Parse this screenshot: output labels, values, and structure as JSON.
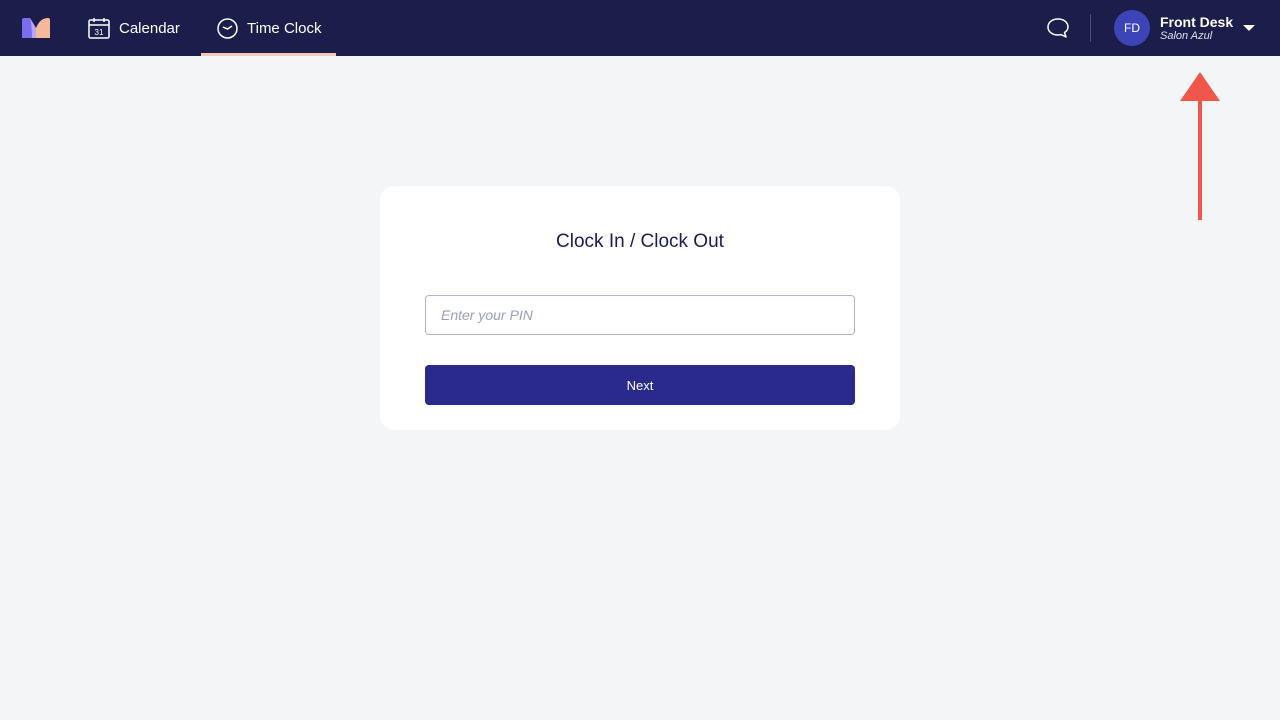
{
  "nav": {
    "items": [
      {
        "label": "Calendar",
        "icon": "calendar-icon"
      },
      {
        "label": "Time Clock",
        "icon": "clock-icon",
        "active": true
      }
    ]
  },
  "user": {
    "initials": "FD",
    "name": "Front Desk",
    "organization": "Salon Azul"
  },
  "card": {
    "title": "Clock In / Clock Out",
    "pin_value": "",
    "pin_placeholder": "Enter your PIN",
    "next_label": "Next"
  },
  "colors": {
    "topbar": "#1b1e4b",
    "accent": "#2a2a8c",
    "active_underline": "#f6c9b5",
    "avatar": "#3d44b8",
    "annotation_arrow": "#f0574a"
  }
}
